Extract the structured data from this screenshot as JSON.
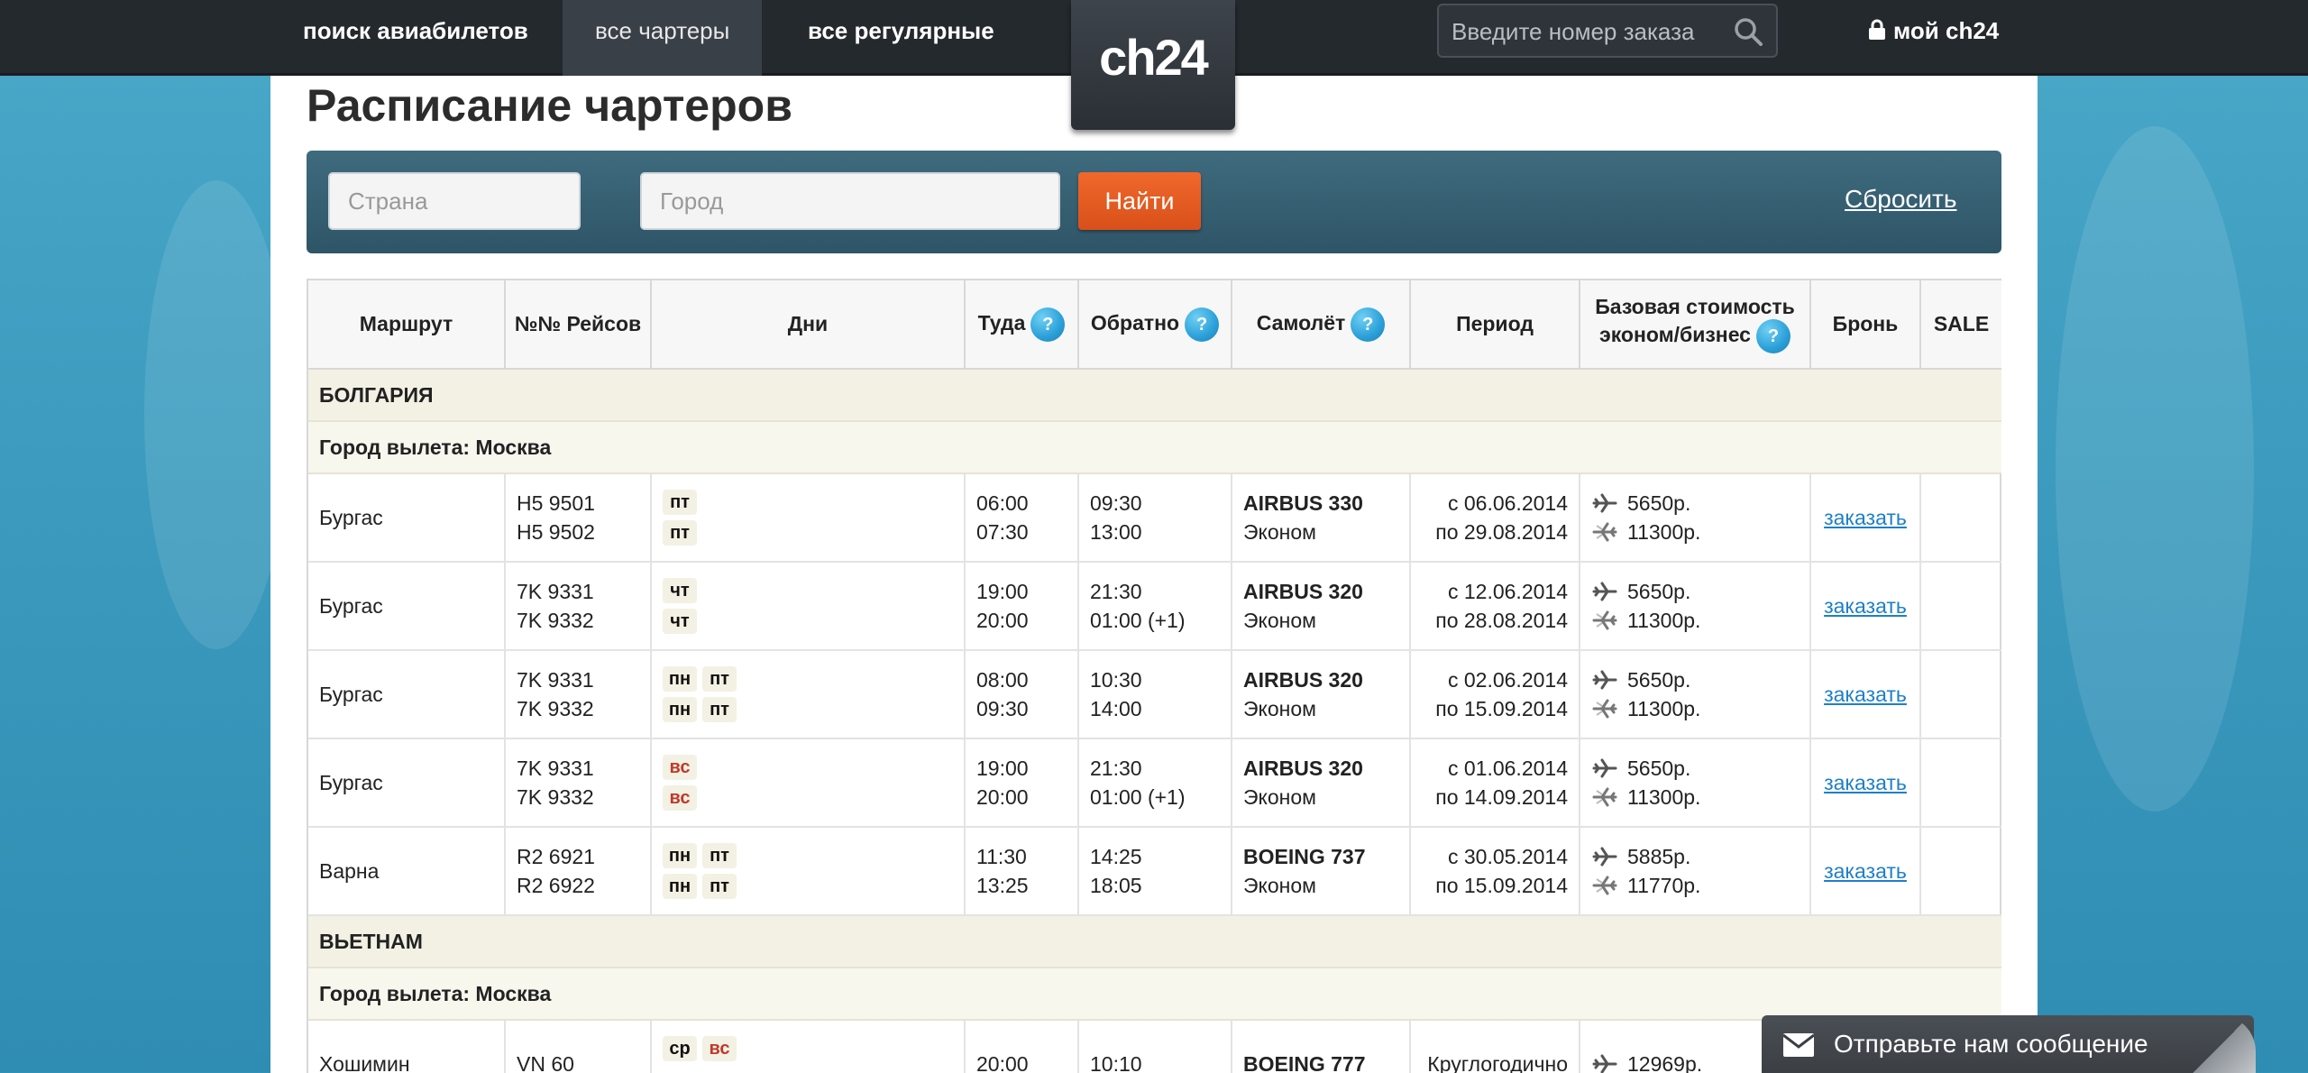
{
  "nav": {
    "search_flights": "поиск авиабилетов",
    "all_charters": "все чартеры",
    "all_regular": "все регулярные",
    "logo": "ch24",
    "order_placeholder": "Введите номер заказа",
    "my_account": "мой ch24"
  },
  "page": {
    "title": "Расписание чартеров"
  },
  "filters": {
    "country_placeholder": "Страна",
    "city_placeholder": "Город",
    "find_label": "Найти",
    "reset_label": "Сбросить"
  },
  "table": {
    "headers": {
      "route": "Маршрут",
      "flights": "№№ Рейсов",
      "days": "Дни",
      "outbound": "Туда",
      "return": "Обратно",
      "aircraft": "Самолёт",
      "period": "Период",
      "base_price_1": "Базовая стоимость",
      "base_price_2": "эконом/бизнес",
      "booking": "Бронь",
      "sale": "SALE"
    },
    "help_mark": "?",
    "groups": [
      {
        "country": "БОЛГАРИЯ",
        "city": "Город вылета: Москва",
        "rows": [
          {
            "route": "Бургас",
            "f1": "H5 9501",
            "f2": "H5 9502",
            "d1": [
              "пт"
            ],
            "d2": [
              "пт"
            ],
            "t1": "06:00",
            "t2": "07:30",
            "r1": "09:30",
            "r2": "13:00",
            "plane": "AIRBUS 330",
            "cls": "Эконом",
            "p1": "с 06.06.2014",
            "p2": "по 29.08.2014",
            "pr1": "5650р.",
            "pr2": "11300р.",
            "book": "заказать"
          },
          {
            "route": "Бургас",
            "f1": "7K 9331",
            "f2": "7K 9332",
            "d1": [
              "чт"
            ],
            "d2": [
              "чт"
            ],
            "t1": "19:00",
            "t2": "20:00",
            "r1": "21:30",
            "r2": "01:00 (+1)",
            "plane": "AIRBUS 320",
            "cls": "Эконом",
            "p1": "с 12.06.2014",
            "p2": "по 28.08.2014",
            "pr1": "5650р.",
            "pr2": "11300р.",
            "book": "заказать"
          },
          {
            "route": "Бургас",
            "f1": "7K 9331",
            "f2": "7K 9332",
            "d1": [
              "пн",
              "пт"
            ],
            "d2": [
              "пн",
              "пт"
            ],
            "t1": "08:00",
            "t2": "09:30",
            "r1": "10:30",
            "r2": "14:00",
            "plane": "AIRBUS 320",
            "cls": "Эконом",
            "p1": "с 02.06.2014",
            "p2": "по 15.09.2014",
            "pr1": "5650р.",
            "pr2": "11300р.",
            "book": "заказать"
          },
          {
            "route": "Бургас",
            "f1": "7K 9331",
            "f2": "7K 9332",
            "d1": [
              "вс"
            ],
            "d2": [
              "вс"
            ],
            "t1": "19:00",
            "t2": "20:00",
            "r1": "21:30",
            "r2": "01:00 (+1)",
            "plane": "AIRBUS 320",
            "cls": "Эконом",
            "p1": "с 01.06.2014",
            "p2": "по 14.09.2014",
            "pr1": "5650р.",
            "pr2": "11300р.",
            "book": "заказать"
          },
          {
            "route": "Варна",
            "f1": "R2 6921",
            "f2": "R2 6922",
            "d1": [
              "пн",
              "пт"
            ],
            "d2": [
              "пн",
              "пт"
            ],
            "t1": "11:30",
            "t2": "13:25",
            "r1": "14:25",
            "r2": "18:05",
            "plane": "BOEING 737",
            "cls": "Эконом",
            "p1": "с 30.05.2014",
            "p2": "по 15.09.2014",
            "pr1": "5885р.",
            "pr2": "11770р.",
            "book": "заказать"
          }
        ]
      },
      {
        "country": "ВЬЕТНАМ",
        "city": "Город вылета: Москва",
        "rows": [
          {
            "route": "Хошимин",
            "f1": "VN 60",
            "f2": "",
            "d1": [
              "ср",
              "вс"
            ],
            "d2": [],
            "t1": "20:00",
            "t2": "",
            "r1": "10:10",
            "r2": "",
            "plane": "BOEING 777",
            "cls": "",
            "p1": "Круглогодично",
            "p2": "",
            "pr1": "12969р.",
            "pr2": "",
            "book": ""
          }
        ]
      }
    ]
  },
  "widget": {
    "message": "Отправьте нам сообщение"
  },
  "colors": {
    "orange": "#e35d21",
    "filter_bg": "#355e70",
    "link": "#1d7fc8",
    "sunday": "#c0392b"
  }
}
